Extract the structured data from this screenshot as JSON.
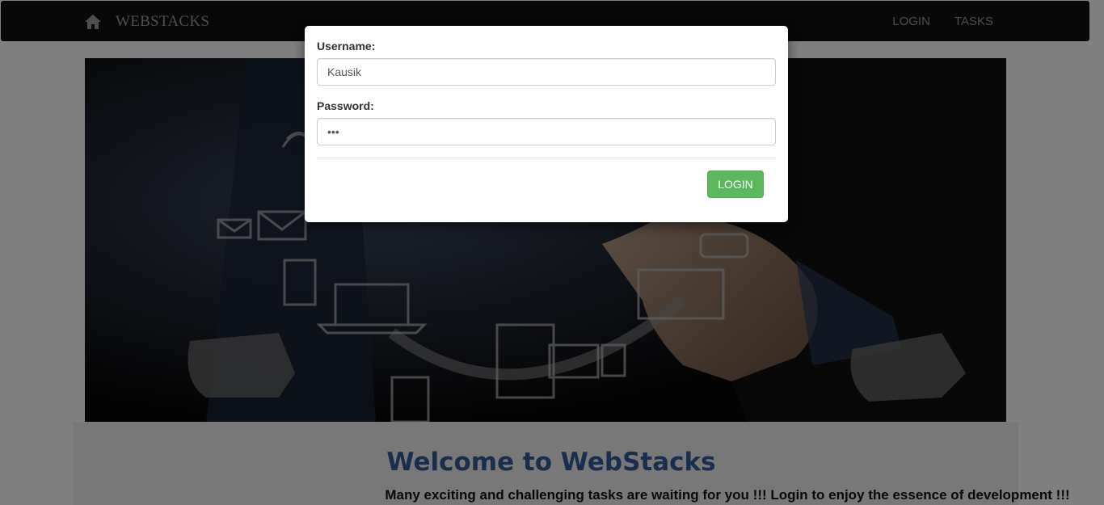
{
  "navbar": {
    "brand": "WEBSTACKS",
    "home_icon": "home-icon",
    "links": [
      {
        "label": "LOGIN"
      },
      {
        "label": "TASKS"
      }
    ]
  },
  "hero": {
    "image_icon": "technology-hand-icon"
  },
  "welcome": {
    "title": "Welcome to WebStacks",
    "subtitle": "Many exciting and challenging tasks are waiting for you !!! Login to enjoy the essence of development !!!"
  },
  "login_modal": {
    "username_label": "Username:",
    "username_value": "Kausik",
    "password_label": "Password:",
    "password_value": "•••",
    "submit_label": "LOGIN",
    "submit_color": "#5cb85c"
  },
  "colors": {
    "navbar_bg": "#111111",
    "title_color": "#335a9e"
  }
}
